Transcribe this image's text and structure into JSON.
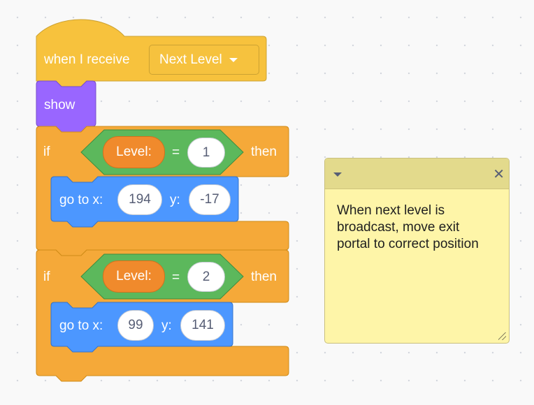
{
  "hat_block": {
    "label": "when I receive",
    "message": "Next Level"
  },
  "show_block": {
    "label": "show"
  },
  "if_blocks": [
    {
      "if_label": "if",
      "then_label": "then",
      "variable": "Level:",
      "operator": "=",
      "compare_value": "1",
      "goto": {
        "label": "go to x:",
        "x": "194",
        "y_label": "y:",
        "y": "-17"
      }
    },
    {
      "if_label": "if",
      "then_label": "then",
      "variable": "Level:",
      "operator": "=",
      "compare_value": "2",
      "goto": {
        "label": "go to x:",
        "x": "99",
        "y_label": "y:",
        "y": "141"
      }
    }
  ],
  "comment": {
    "text": "When next level is broadcast, move exit portal to correct position",
    "close_icon": "close-x-icon",
    "collapse_icon": "collapse-triangle-icon"
  },
  "colors": {
    "events": "#ffbf00",
    "looks": "#9966ff",
    "control": "#ffab19",
    "operators": "#59c059",
    "variables": "#ff8c1a",
    "motion": "#4c97ff",
    "comment": "#fef5a8"
  }
}
